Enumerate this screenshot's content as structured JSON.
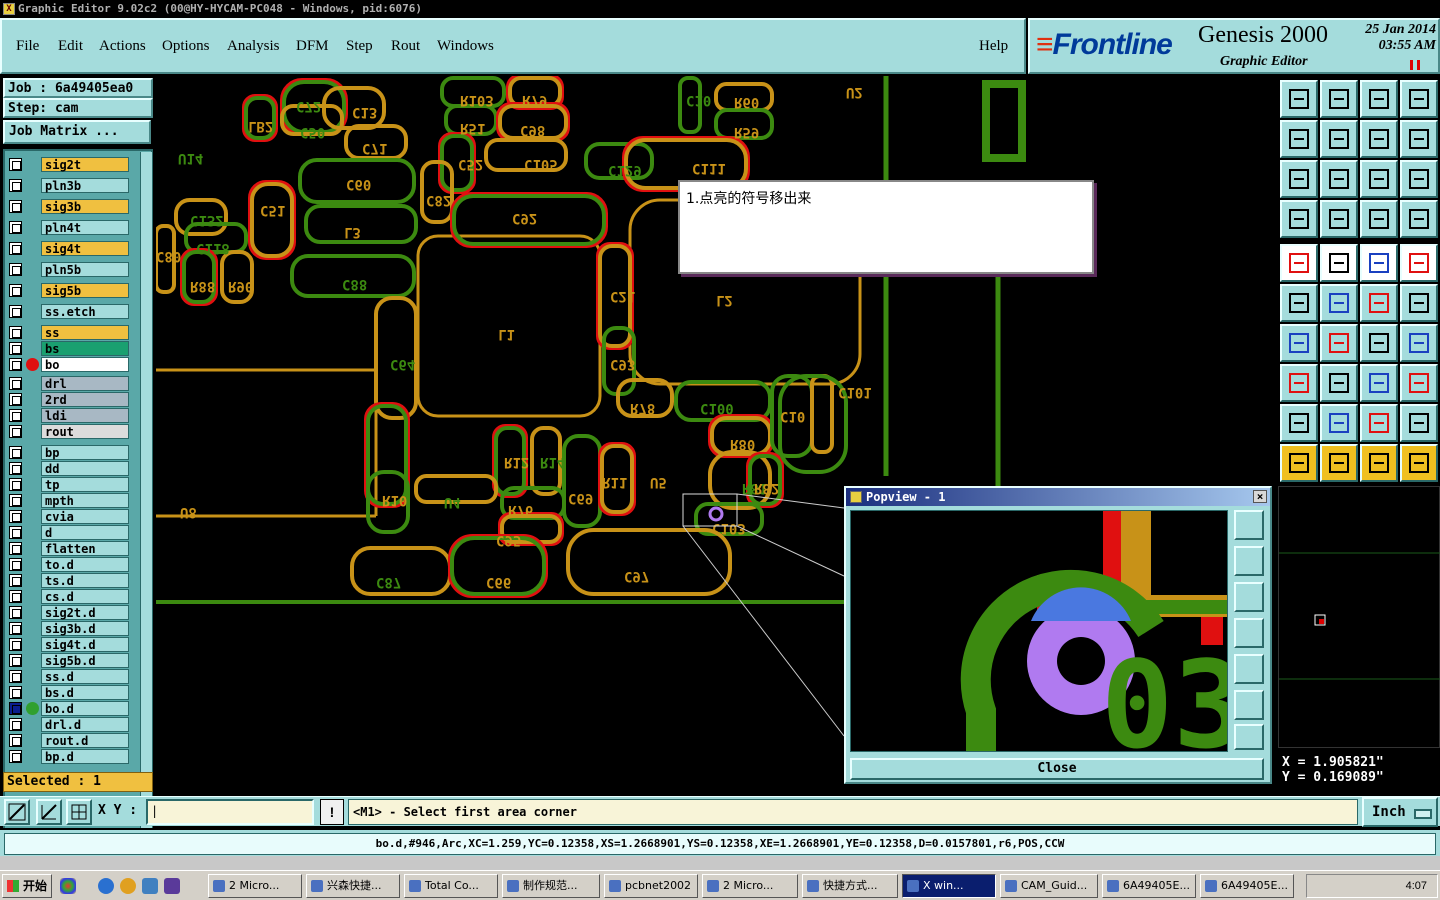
{
  "window": {
    "title": "Graphic Editor 9.02c2 (00@HY-HYCAM-PC048 - Windows, pid:6076)"
  },
  "menu": [
    "File",
    "Edit",
    "Actions",
    "Options",
    "Analysis",
    "DFM",
    "Step",
    "Rout",
    "Windows",
    "Help"
  ],
  "brand": {
    "logo": "Frontline",
    "product": "Genesis 2000",
    "subtitle": "Graphic Editor",
    "date": "25 Jan 2014",
    "time": "03:55 AM"
  },
  "job": {
    "job_label": "Job : 6a49405ea0",
    "step_label": "Step: cam",
    "matrix_button": "Job Matrix ..."
  },
  "layers": [
    {
      "name": "sig2t",
      "color": "#f0c040"
    },
    {
      "name": "pln3b",
      "color": "#a4dcdc"
    },
    {
      "name": "sig3b",
      "color": "#f0c040"
    },
    {
      "name": "pln4t",
      "color": "#a4dcdc"
    },
    {
      "name": "sig4t",
      "color": "#f0c040"
    },
    {
      "name": "pln5b",
      "color": "#a4dcdc"
    },
    {
      "name": "sig5b",
      "color": "#f0c040"
    },
    {
      "name": "ss.etch",
      "color": "#a4dcdc"
    },
    {
      "name": "ss",
      "color": "#f0c040"
    },
    {
      "name": "bs",
      "color": "#1aa070"
    },
    {
      "name": "bo",
      "color": "#ffffff"
    },
    {
      "name": "drl",
      "color": "#a8b8c4"
    },
    {
      "name": "2rd",
      "color": "#a8b8c4"
    },
    {
      "name": "ldi",
      "color": "#a8b8c4"
    },
    {
      "name": "rout",
      "color": "#dcdcdc"
    },
    {
      "name": "bp",
      "color": "#a4dcdc"
    },
    {
      "name": "dd",
      "color": "#a4dcdc"
    },
    {
      "name": "tp",
      "color": "#a4dcdc"
    },
    {
      "name": "mpth",
      "color": "#a4dcdc"
    },
    {
      "name": "cvia",
      "color": "#a4dcdc"
    },
    {
      "name": "d",
      "color": "#a4dcdc"
    },
    {
      "name": "flatten",
      "color": "#a4dcdc"
    },
    {
      "name": "to.d",
      "color": "#a4dcdc"
    },
    {
      "name": "ts.d",
      "color": "#a4dcdc"
    },
    {
      "name": "cs.d",
      "color": "#a4dcdc"
    },
    {
      "name": "sig2t.d",
      "color": "#a4dcdc"
    },
    {
      "name": "sig3b.d",
      "color": "#a4dcdc"
    },
    {
      "name": "sig4t.d",
      "color": "#a4dcdc"
    },
    {
      "name": "sig5b.d",
      "color": "#a4dcdc"
    },
    {
      "name": "ss.d",
      "color": "#a4dcdc"
    },
    {
      "name": "bs.d",
      "color": "#a4dcdc"
    },
    {
      "name": "bo.d",
      "color": "#a4dcdc"
    },
    {
      "name": "drl.d",
      "color": "#a4dcdc"
    },
    {
      "name": "rout.d",
      "color": "#a4dcdc"
    },
    {
      "name": "bp.d",
      "color": "#a4dcdc"
    }
  ],
  "selected": "Selected : 1",
  "callout": "1.点亮的符号移出来",
  "popview": {
    "title": "Popview - 1",
    "close": "Close"
  },
  "coords": {
    "x": "X = 1.905821\"",
    "y": "Y = 0.169089\""
  },
  "command": {
    "xy_label": "X Y :",
    "prompt": "<M1> - Select first area corner",
    "unit": "Inch"
  },
  "info": "bo.d,#946,Arc,XC=1.259,YC=0.12358,XS=1.2668901,YS=0.12358,XE=1.2668901,YE=0.12358,D=0.0157801,r6,POS,CCW",
  "taskbar": {
    "start": "开始",
    "tasks": [
      "2 Micro...",
      "兴森快捷...",
      "Total Co...",
      "制作规范...",
      "pcbnet2002",
      "2 Micro...",
      "快捷方式...",
      "X win...",
      "CAM_Guid...",
      "6A49405E...",
      "6A49405E..."
    ],
    "clock": "4:07"
  },
  "labels": [
    "C72",
    "C13",
    "R103",
    "R79",
    "C10",
    "R60",
    "U2",
    "LB2",
    "C50",
    "R51",
    "C98",
    "R59",
    "U14",
    "C71",
    "C52",
    "C105",
    "C129",
    "C111",
    "C60",
    "C82",
    "C132",
    "C51",
    "L3",
    "C92",
    "C118",
    "C80",
    "R88",
    "R90",
    "C88",
    "C21",
    "L2",
    "L1",
    "C64",
    "C93",
    "C101",
    "R78",
    "C100",
    "R80",
    "C10",
    "R12",
    "R14",
    "C69",
    "R11",
    "U5",
    "R81",
    "R82",
    "U8",
    "R10",
    "U4",
    "R76",
    "C103",
    "C95",
    "C87",
    "C66",
    "C97"
  ],
  "colors": {
    "green": "#3c8a10",
    "orange": "#c89218",
    "red": "#e01010",
    "accent": "#a4dcdc"
  }
}
